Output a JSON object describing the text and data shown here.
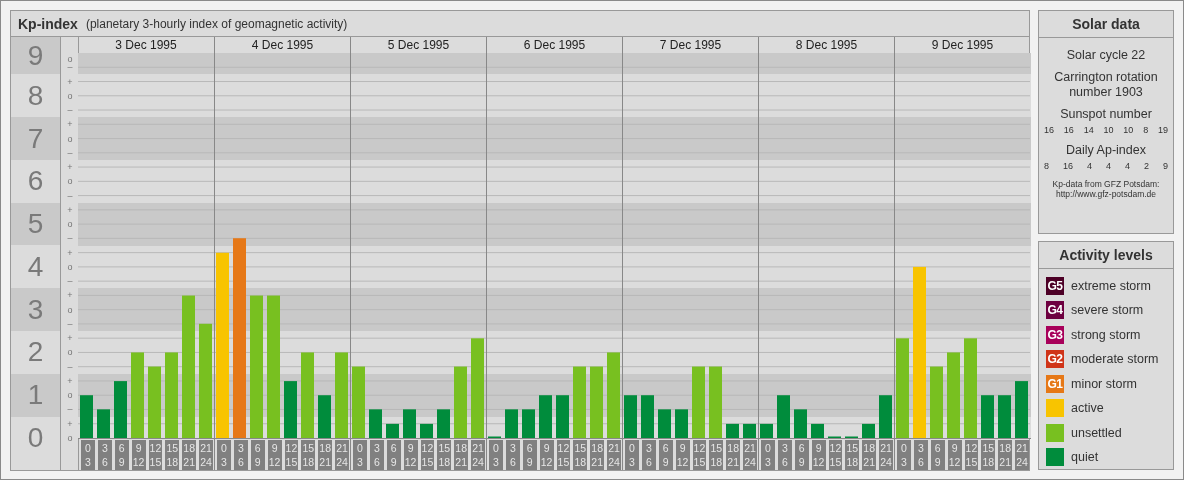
{
  "title": "Kp-index",
  "subtitle": "(planetary 3-hourly index of geomagnetic activity)",
  "kp_chart": {
    "dates": [
      "3 Dec 1995",
      "4 Dec 1995",
      "5 Dec 1995",
      "6 Dec 1995",
      "7 Dec 1995",
      "8 Dec 1995",
      "9 Dec 1995"
    ],
    "minor_ticks": [
      "o",
      "–",
      "+",
      "o",
      "–",
      "+",
      "o",
      "–",
      "+",
      "o",
      "–",
      "+",
      "o",
      "–",
      "+",
      "o",
      "–",
      "+",
      "o",
      "–",
      "+",
      "o",
      "–",
      "+",
      "o",
      "–",
      "+",
      "o"
    ],
    "chart_data": {
      "type": "bar",
      "ylim": [
        0,
        9
      ],
      "grid": true,
      "yticks": [
        {
          "value": 0,
          "label": "0"
        },
        {
          "value": 1,
          "label": "1"
        },
        {
          "value": 2,
          "label": "2"
        },
        {
          "value": 3,
          "label": "3"
        },
        {
          "value": 4,
          "label": "4"
        },
        {
          "value": 5,
          "label": "5"
        },
        {
          "value": 6,
          "label": "6"
        },
        {
          "value": 7,
          "label": "7"
        },
        {
          "value": 8,
          "label": "8"
        },
        {
          "value": 9,
          "label": "9"
        }
      ],
      "categories": [
        "0\n3",
        "3\n6",
        "6\n9",
        "9\n12",
        "12\n15",
        "15\n18",
        "18\n21",
        "21\n24",
        "0\n3",
        "3\n6",
        "6\n9",
        "9\n12",
        "12\n15",
        "15\n18",
        "18\n21",
        "21\n24",
        "0\n3",
        "3\n6",
        "6\n9",
        "9\n12",
        "12\n15",
        "15\n18",
        "18\n21",
        "21\n24",
        "0\n3",
        "3\n6",
        "6\n9",
        "9\n12",
        "12\n15",
        "15\n18",
        "18\n21",
        "21\n24",
        "0\n3",
        "3\n6",
        "6\n9",
        "9\n12",
        "12\n15",
        "15\n18",
        "18\n21",
        "21\n24",
        "0\n3",
        "3\n6",
        "6\n9",
        "9\n12",
        "12\n15",
        "15\n18",
        "18\n21",
        "21\n24",
        "0\n3",
        "3\n6",
        "6\n9",
        "9\n12",
        "12\n15",
        "15\n18",
        "18\n21",
        "21\n24"
      ],
      "series": [
        {
          "values": [
            1,
            0.67,
            1.33,
            2,
            1.67,
            2,
            3.33,
            2.67,
            4.33,
            4.67,
            3.33,
            3.33,
            1.33,
            2,
            1,
            2,
            1.67,
            0.67,
            0.33,
            0.67,
            0.33,
            0.67,
            1.67,
            2.33,
            0,
            0.67,
            0.67,
            1,
            1,
            1.67,
            1.67,
            2,
            1,
            1,
            0.67,
            0.67,
            1.67,
            1.67,
            0.33,
            0.33,
            0.33,
            1,
            0.67,
            0.33,
            0,
            0,
            0.33,
            1,
            2.33,
            4,
            1.67,
            2,
            2.33,
            1,
            1,
            1.33
          ]
        }
      ]
    }
  },
  "solar_data": {
    "title": "Solar data",
    "cycle": "Solar cycle 22",
    "rotation": "Carrington rotation number 1903",
    "sunspot_label": "Sunspot number",
    "sunspots": [
      "16",
      "16",
      "14",
      "10",
      "10",
      "8",
      "19"
    ],
    "ap_label": "Daily Ap-index",
    "ap": [
      "8",
      "16",
      "4",
      "4",
      "4",
      "2",
      "9"
    ],
    "credit": "Kp-data from GFZ Potsdam:",
    "credit_url": "http://www.gfz-potsdam.de"
  },
  "activity_levels": {
    "title": "Activity levels",
    "items": [
      {
        "badge": "G5",
        "label": "extreme storm",
        "color": "#4d0026"
      },
      {
        "badge": "G4",
        "label": "severe storm",
        "color": "#6e0040"
      },
      {
        "badge": "G3",
        "label": "strong storm",
        "color": "#a8005a"
      },
      {
        "badge": "G2",
        "label": "moderate storm",
        "color": "#d03418"
      },
      {
        "badge": "G1",
        "label": "minor storm",
        "color": "#e67817"
      },
      {
        "label": "active",
        "color": "#f8c400"
      },
      {
        "label": "unsettled",
        "color": "#78c020"
      },
      {
        "label": "quiet",
        "color": "#008c3c"
      }
    ]
  }
}
